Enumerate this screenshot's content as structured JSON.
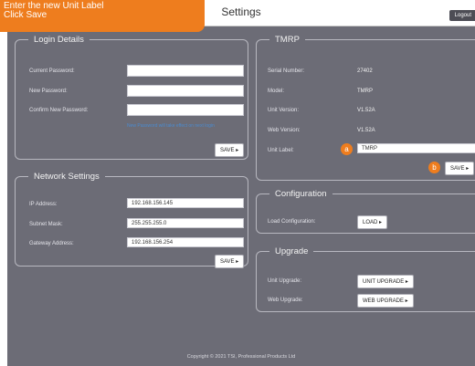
{
  "callout": {
    "line1": "Enter the new Unit Label",
    "line2": "Click Save"
  },
  "header": {
    "title": "Settings",
    "logout_label": "Logout"
  },
  "login": {
    "legend": "Login Details",
    "current_label": "Current Password:",
    "new_label": "New Password:",
    "confirm_label": "Confirm New Password:",
    "current_value": "",
    "new_value": "",
    "confirm_value": "",
    "note": "New Password will take effect on next login",
    "save_label": "SAVE ▸"
  },
  "network": {
    "legend": "Network Settings",
    "ip_label": "IP Address:",
    "subnet_label": "Subnet Mask:",
    "gateway_label": "Gateway Address:",
    "ip_value": "192.168.156.145",
    "subnet_value": "255.255.255.0",
    "gateway_value": "192.168.156.254",
    "save_label": "SAVE ▸"
  },
  "tmrp": {
    "legend": "TMRP",
    "serial_label": "Serial Number:",
    "serial_value": "27402",
    "model_label": "Model:",
    "model_value": "TMRP",
    "unit_version_label": "Unit Version:",
    "unit_version_value": "V1.52A",
    "web_version_label": "Web Version:",
    "web_version_value": "V1.52A",
    "unit_label_label": "Unit Label:",
    "unit_label_value": "TMRP",
    "badge_a": "a",
    "badge_b": "b",
    "save_label": "SAVE ▸"
  },
  "configuration": {
    "legend": "Configuration",
    "load_label": "Load Configuration:",
    "load_button": "LOAD ▸"
  },
  "upgrade": {
    "legend": "Upgrade",
    "unit_label": "Unit Upgrade:",
    "unit_button": "UNIT UPGRADE ▸",
    "web_label": "Web Upgrade:",
    "web_button": "WEB UPGRADE ▸"
  },
  "footer": {
    "copyright": "Copyright © 2021 TSI, Professional Products Ltd"
  }
}
